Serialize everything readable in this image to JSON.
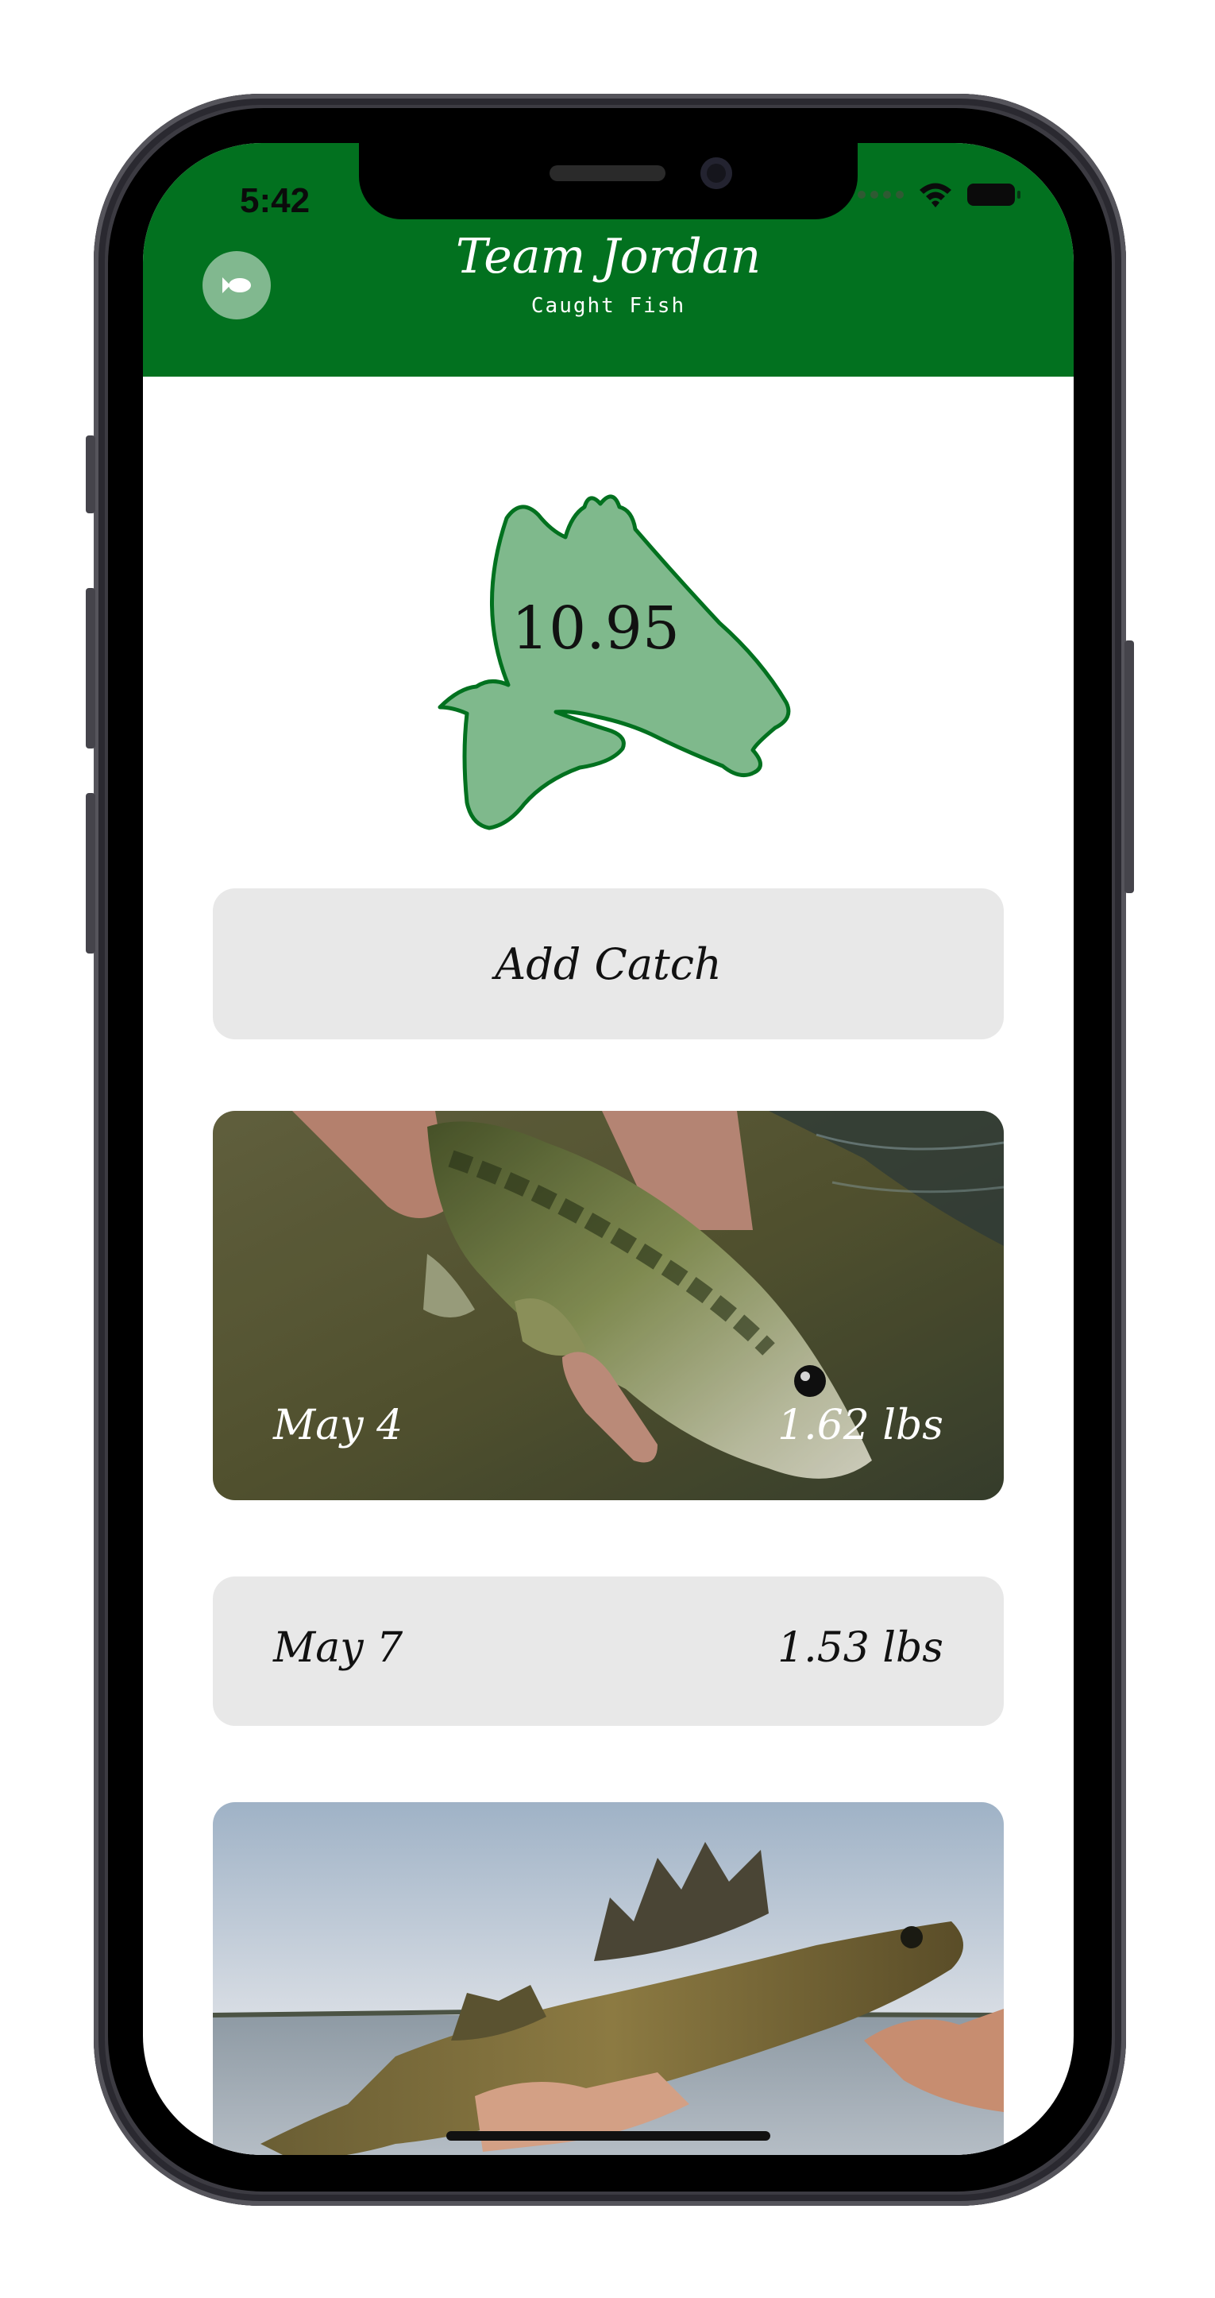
{
  "status_bar": {
    "time": "5:42"
  },
  "header": {
    "title": "Team Jordan",
    "subtitle": "Caught Fish",
    "menu_icon": "fish-icon",
    "color": "#02711f"
  },
  "total": {
    "value": "10.95",
    "fill": "#7fb98c",
    "stroke": "#02711f"
  },
  "add_button": {
    "label": "Add Catch"
  },
  "catches": [
    {
      "date": "May 4",
      "weight": "1.62 lbs",
      "has_photo": true,
      "photo": "largemouth bass held over water"
    },
    {
      "date": "May 7",
      "weight": "1.53 lbs",
      "has_photo": false
    },
    {
      "date": "",
      "weight": "",
      "has_photo": true,
      "photo": "walleye held over lake"
    }
  ]
}
